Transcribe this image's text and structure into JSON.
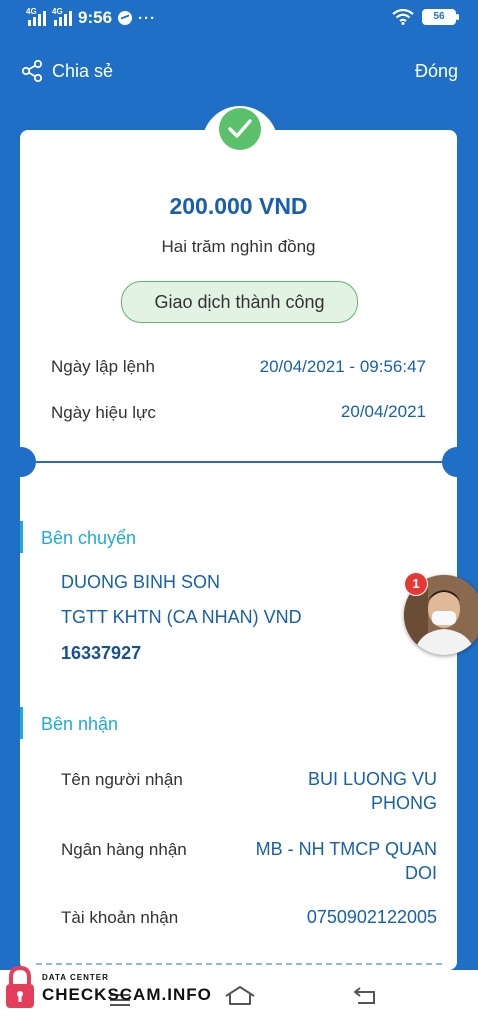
{
  "status_bar": {
    "network1": "4G",
    "network2": "4G",
    "time": "9:56",
    "dots": "···",
    "battery": "56"
  },
  "header": {
    "share_label": "Chia sẻ",
    "close_label": "Đóng"
  },
  "transaction": {
    "amount": "200.000 VND",
    "amount_words": "Hai trăm nghìn đồng",
    "status": "Giao dịch thành công",
    "order_date_label": "Ngày lập lệnh",
    "order_date_value": "20/04/2021 - 09:56:47",
    "effective_date_label": "Ngày hiệu lực",
    "effective_date_value": "20/04/2021"
  },
  "sender": {
    "title": "Bên chuyển",
    "name": "DUONG BINH SON",
    "account_type": "TGTT KHTN (CA NHAN) VND",
    "account_number": "16337927"
  },
  "receiver": {
    "title": "Bên nhận",
    "name_label": "Tên người nhận",
    "name_line1": "BUI LUONG VU",
    "name_line2": "PHONG",
    "bank_label": "Ngân hàng nhận",
    "bank_line1": "MB - NH TMCP QUAN",
    "bank_line2": "DOI",
    "account_label": "Tài khoản nhận",
    "account_value": "0750902122005"
  },
  "chat_head": {
    "badge": "1"
  },
  "watermark": {
    "small": "DATA CENTER",
    "big": "CHECKSCAM.INFO"
  },
  "colors": {
    "brand_blue": "#1f6fc7",
    "amount_blue": "#1a5fac",
    "section_cyan": "#23a9d8",
    "success_green": "#5bc26b"
  }
}
